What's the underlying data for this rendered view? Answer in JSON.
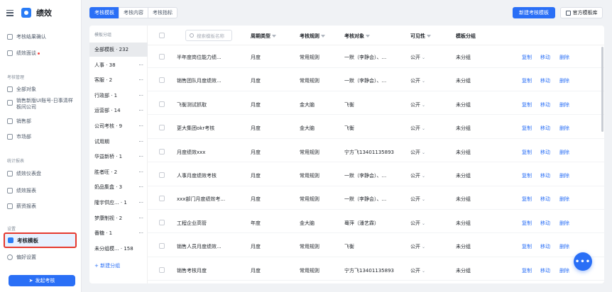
{
  "app": {
    "title": "绩效"
  },
  "sidebar": {
    "items_top": [
      {
        "label": "考核结果确认",
        "icon": "person-icon",
        "dot": false
      },
      {
        "label": "绩效面谈",
        "icon": "chat-icon",
        "dot": true
      }
    ],
    "group_manage": "考核管理",
    "items_manage": [
      {
        "label": "全部对象",
        "icon": "grid-icon"
      },
      {
        "label": "销售新版UI账号-日事清样板间公司",
        "icon": "org-icon"
      },
      {
        "label": "销售部",
        "icon": "org-icon"
      },
      {
        "label": "市场部",
        "icon": "org-icon"
      }
    ],
    "group_report": "统计报表",
    "items_report": [
      {
        "label": "绩效仪表盘",
        "icon": "dashboard-icon"
      },
      {
        "label": "绩效报表",
        "icon": "report-icon"
      },
      {
        "label": "薪资报表",
        "icon": "money-icon"
      }
    ],
    "group_settings": "设置",
    "active_item": "考核模板",
    "item_pref": "偏好设置",
    "launch_label": "发起考核"
  },
  "tabs": [
    "考核模板",
    "考核内容",
    "考核指标"
  ],
  "actions": {
    "new_template": "新建考核模板",
    "official_library": "官方模板库"
  },
  "groups": {
    "header": "模板分组",
    "items": [
      {
        "label": "全部模板 · 232",
        "more": false
      },
      {
        "label": "人事 · 38",
        "more": true
      },
      {
        "label": "客服 · 2",
        "more": true
      },
      {
        "label": "行政部 · 1",
        "more": true
      },
      {
        "label": "运营部 · 14",
        "more": true
      },
      {
        "label": "公司考核 · 9",
        "more": true
      },
      {
        "label": "试用期",
        "more": true
      },
      {
        "label": "华益新桥 · 1",
        "more": true
      },
      {
        "label": "胜者旺 · 2",
        "more": true
      },
      {
        "label": "奶品集盒 · 3",
        "more": true
      },
      {
        "label": "隆宇供应... · 1",
        "more": true
      },
      {
        "label": "梦康制视 · 2",
        "more": true
      },
      {
        "label": "番糖 · 1",
        "more": true
      },
      {
        "label": "未分组模... · 158",
        "more": false
      }
    ],
    "add_label": "+ 新建分组",
    "more_glyph": "···"
  },
  "table": {
    "search_placeholder": "搜索模板名称",
    "columns": [
      "周期类型",
      "考核规则",
      "考核对象",
      "可见性",
      "模板分组"
    ],
    "rows": [
      {
        "name": "半年度岗位能力绩...",
        "period": "月度",
        "rule": "常用规则",
        "target": "一默（李静会）、...",
        "visibility": "公开",
        "group": "未分组"
      },
      {
        "name": "销售团队月度绩效...",
        "period": "月度",
        "rule": "常用规则",
        "target": "一默（李静会）、...",
        "visibility": "公开",
        "group": "未分组"
      },
      {
        "name": "飞衡测试抓取",
        "period": "月度",
        "rule": "金大脑",
        "target": "飞衡",
        "visibility": "公开",
        "group": "未分组"
      },
      {
        "name": "更大集团okr考核",
        "period": "月度",
        "rule": "金大脑",
        "target": "飞衡",
        "visibility": "公开",
        "group": "未分组"
      },
      {
        "name": "月度绩效xxx",
        "period": "月度",
        "rule": "常用规则",
        "target": "宁方飞13401135893",
        "visibility": "公开",
        "group": "未分组"
      },
      {
        "name": "人事月度绩效考核",
        "period": "月度",
        "rule": "常用规则",
        "target": "一默（李静会）、...",
        "visibility": "公开",
        "group": "未分组"
      },
      {
        "name": "xxx部门月度绩效考...",
        "period": "月度",
        "rule": "常用规则",
        "target": "一默（李静会）、...",
        "visibility": "公开",
        "group": "未分组"
      },
      {
        "name": "工程企业高管",
        "period": "年度",
        "rule": "金大脑",
        "target": "蓦萍（潘艺霖）",
        "visibility": "公开",
        "group": "未分组"
      },
      {
        "name": "销售人员月度绩效...",
        "period": "月度",
        "rule": "常用规则",
        "target": "飞衡",
        "visibility": "公开",
        "group": "未分组"
      },
      {
        "name": "销售考核月度",
        "period": "月度",
        "rule": "常用规则",
        "target": "宁方飞13401135893",
        "visibility": "公开",
        "group": "未分组"
      }
    ],
    "ops": {
      "copy": "复制",
      "move": "移动",
      "delete": "删除"
    },
    "caret": "⌄"
  },
  "fab_label": "•••"
}
